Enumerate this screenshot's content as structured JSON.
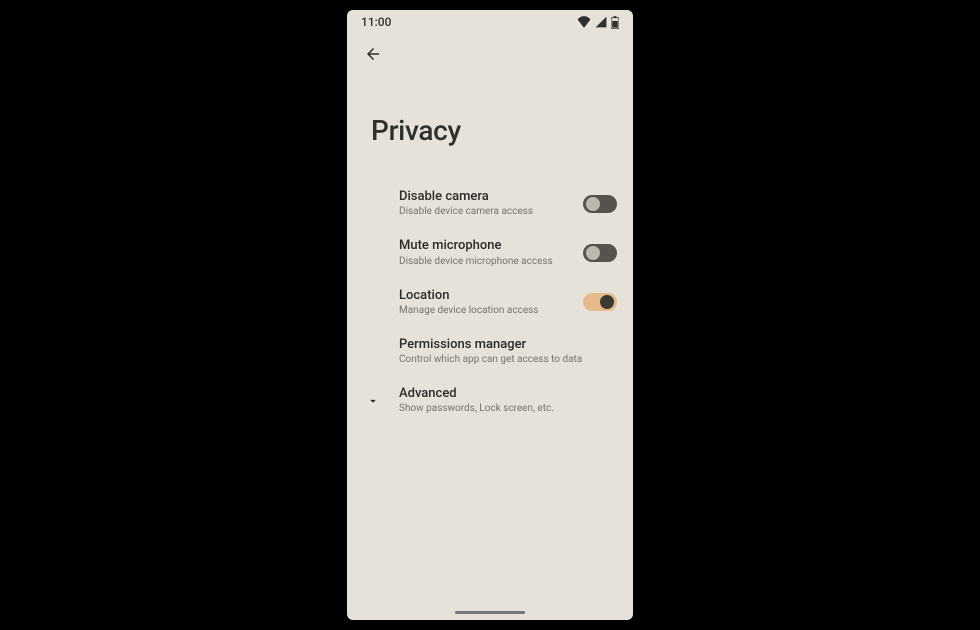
{
  "status": {
    "time": "11:00"
  },
  "page": {
    "title": "Privacy"
  },
  "settings": [
    {
      "title": "Disable camera",
      "subtitle": "Disable device camera access",
      "toggle": "off"
    },
    {
      "title": "Mute microphone",
      "subtitle": "Disable device microphone access",
      "toggle": "off"
    },
    {
      "title": "Location",
      "subtitle": "Manage device location access",
      "toggle": "on"
    },
    {
      "title": "Permissions manager",
      "subtitle": "Control which app can get access to data"
    },
    {
      "title": "Advanced",
      "subtitle": "Show passwords, Lock screen, etc.",
      "expandable": true
    }
  ],
  "colors": {
    "background": "#e7e2d9",
    "toggle_off_track": "#56534d",
    "toggle_off_knob": "#bdb8ae",
    "toggle_on_track": "#e6b98a",
    "toggle_on_knob": "#3b3933"
  }
}
